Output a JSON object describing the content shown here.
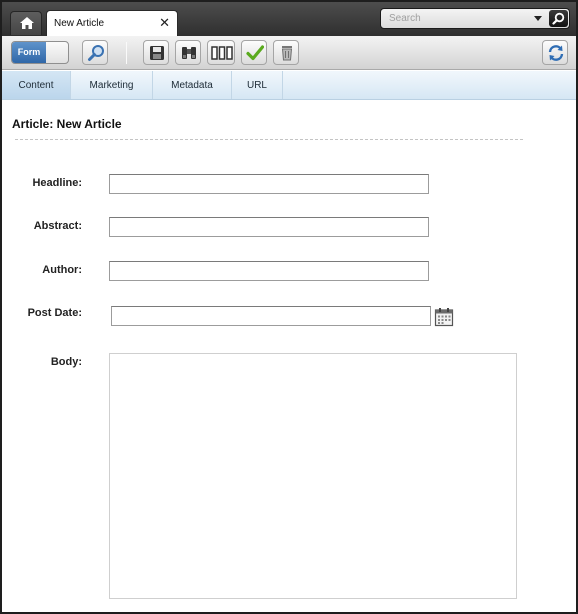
{
  "topbar": {
    "home_icon": "home-icon",
    "tab_label": "New Article",
    "close_glyph": "✕",
    "search_placeholder": "Search"
  },
  "toolbar": {
    "toggle_label": "Form",
    "icons": [
      "preview-magnifier-icon",
      "save-icon",
      "compare-binoculars-icon",
      "versions-icon",
      "approve-check-icon",
      "delete-trash-icon",
      "refresh-icon"
    ]
  },
  "tabs": [
    {
      "label": "Content"
    },
    {
      "label": "Marketing"
    },
    {
      "label": "Metadata"
    },
    {
      "label": "URL"
    }
  ],
  "form": {
    "title": "Article: New Article",
    "headline_label": "Headline:",
    "abstract_label": "Abstract:",
    "author_label": "Author:",
    "post_date_label": "Post Date:",
    "body_label": "Body:",
    "headline_value": "",
    "abstract_value": "",
    "author_value": "",
    "post_date_value": "",
    "body_value": ""
  },
  "colors": {
    "accent": "#3a72b2",
    "tab_active": "#c6ddf0",
    "topbar": "#3c3c3c"
  }
}
